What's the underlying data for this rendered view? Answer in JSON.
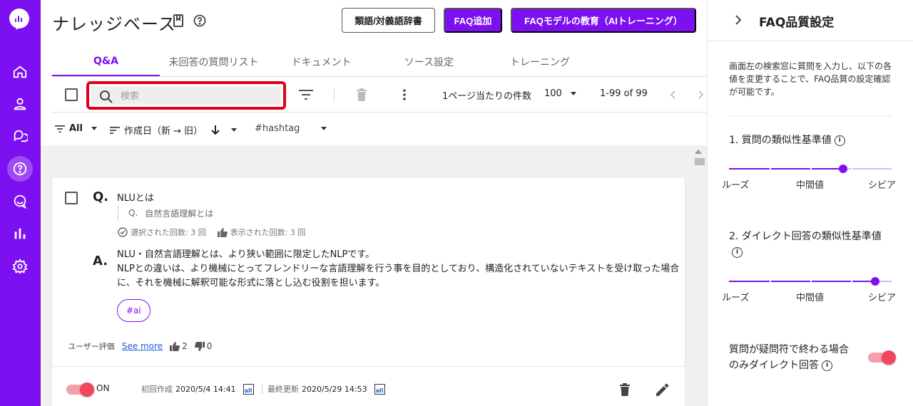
{
  "page": {
    "title": "ナレッジベース"
  },
  "header": {
    "dictionary_button": "類語/対義語辞書",
    "add_faq_button": "FAQ追加",
    "train_button": "FAQモデルの教育（AIトレーニング）"
  },
  "tabs": [
    {
      "label": "Q&A",
      "active": true
    },
    {
      "label": "未回答の質問リスト",
      "active": false
    },
    {
      "label": "ドキュメント",
      "active": false
    },
    {
      "label": "ソース設定",
      "active": false
    },
    {
      "label": "トレーニング",
      "active": false
    }
  ],
  "toolbar": {
    "search_placeholder": "検索",
    "per_page_label": "1ページ当たりの件数",
    "per_page_value": "100",
    "range": "1-99 of 99"
  },
  "filters": {
    "status": "All",
    "sort": "作成日（新 → 旧）",
    "hashtag": "#hashtag"
  },
  "faq_item": {
    "q_letter": "Q.",
    "question": "NLUとは",
    "alt_q_letter": "Q.",
    "alt_question": "自然言語理解とは",
    "selected_count": "選択された回数: 3 回",
    "displayed_count": "表示された回数: 3 回",
    "a_letter": "A.",
    "answer_line1": "NLU・自然言語理解とは、より狭い範囲に限定したNLPです。",
    "answer_line2": "NLPとの違いは、より機械にとってフレンドリーな言語理解を行う事を目的としており、構造化されていないテキストを受け取った場合に、それを機械に解釈可能な形式に落とし込む役割を担います。",
    "tag": "#ai",
    "rating_label": "ユーザー評価",
    "see_more": "See more",
    "likes": "2",
    "dislikes": "0",
    "toggle_label": "ON",
    "enabled": true,
    "created_label": "初回作成",
    "created_at": "2020/5/4 14:41",
    "updated_label": "最終更新",
    "updated_at": "2020/5/29 14:53",
    "ai_badge": "all"
  },
  "panel": {
    "title": "FAQ品質設定",
    "description": "画面左の検索窓に質問を入力し、以下の各値を変更することで、FAQ品質の設定確認が可能です。",
    "setting1_label": "1. 質問の類似性基準値",
    "setting1_value": 0.7,
    "setting2_label": "2. ダイレクト回答の類似性基準値",
    "setting2_value": 0.9,
    "slider_low": "ルーズ",
    "slider_mid": "中間値",
    "slider_high": "シビア",
    "setting3_label": "質問が疑問符で終わる場合のみダイレクト回答",
    "setting3_enabled": true,
    "info_glyph": "i"
  },
  "colors": {
    "brand": "#7d10f0",
    "highlight": "#e0001b",
    "toggle_on": "#f1465f"
  }
}
